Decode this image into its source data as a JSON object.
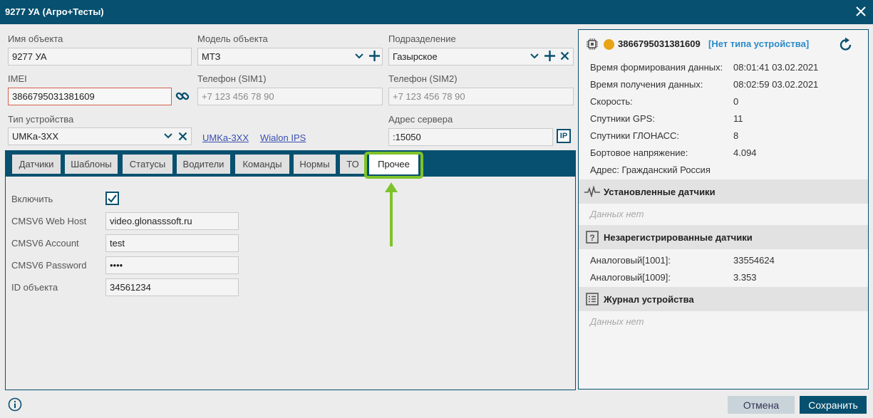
{
  "window": {
    "title": "9277 УА (Агро+Тесты)"
  },
  "fields": {
    "object_name": {
      "label": "Имя объекта",
      "value": "9277 УА"
    },
    "object_model": {
      "label": "Модель объекта",
      "value": "МТЗ"
    },
    "department": {
      "label": "Подразделение",
      "value": "Газырское"
    },
    "imei": {
      "label": "IMEI",
      "value": "3866795031381609"
    },
    "phone_sim1": {
      "label": "Телефон (SIM1)",
      "placeholder": "+7 123 456 78 90"
    },
    "phone_sim2": {
      "label": "Телефон (SIM2)",
      "placeholder": "+7 123 456 78 90"
    },
    "device_type": {
      "label": "Тип устройства",
      "value": "UMKa-3XX"
    },
    "device_links": [
      "UMKa-3XX",
      "Wialon IPS"
    ],
    "server_address": {
      "label": "Адрес сервера",
      "value": ":15050"
    },
    "ip_button": "IP"
  },
  "tabs": [
    "Датчики",
    "Шаблоны",
    "Статусы",
    "Водители",
    "Команды",
    "Нормы",
    "ТО",
    "Прочее"
  ],
  "active_tab": "Прочее",
  "other_tab": {
    "enable": {
      "label": "Включить",
      "checked": true
    },
    "web_host": {
      "label": "CMSV6 Web Host",
      "value": "video.glonasssoft.ru"
    },
    "account": {
      "label": "CMSV6 Account",
      "value": "test"
    },
    "password": {
      "label": "CMSV6 Password",
      "value": "••••"
    },
    "object_id": {
      "label": "ID объекта",
      "value": "34561234"
    }
  },
  "device_panel": {
    "imei": "3866795031381609",
    "device_type": "[Нет типа устройства]",
    "status_color": "#e8a317",
    "rows": [
      {
        "label": "Время формирования данных:",
        "value": "08:01:41 03.02.2021"
      },
      {
        "label": "Время получения данных:",
        "value": "08:02:59 03.02.2021"
      },
      {
        "label": "Скорость:",
        "value": "0"
      },
      {
        "label": "Спутники GPS:",
        "value": "11"
      },
      {
        "label": "Спутники ГЛОНАСС:",
        "value": "8"
      },
      {
        "label": "Бортовое напряжение:",
        "value": "4.094"
      }
    ],
    "address": "Адрес: Гражданский Россия",
    "installed_sensors": {
      "title": "Установленные датчики",
      "empty": "Данных нет"
    },
    "unregistered_sensors": {
      "title": "Незарегистрированные датчики",
      "rows": [
        {
          "label": "Аналоговый[1001]:",
          "value": "33554624"
        },
        {
          "label": "Аналоговый[1009]:",
          "value": "3.353"
        }
      ]
    },
    "device_log": {
      "title": "Журнал устройства",
      "empty": "Данных нет"
    }
  },
  "footer": {
    "cancel": "Отмена",
    "save": "Сохранить"
  },
  "colors": {
    "header": "#07506f",
    "highlight": "#7ec32a",
    "link": "#3a4fb0",
    "error_border": "#d6604a"
  }
}
